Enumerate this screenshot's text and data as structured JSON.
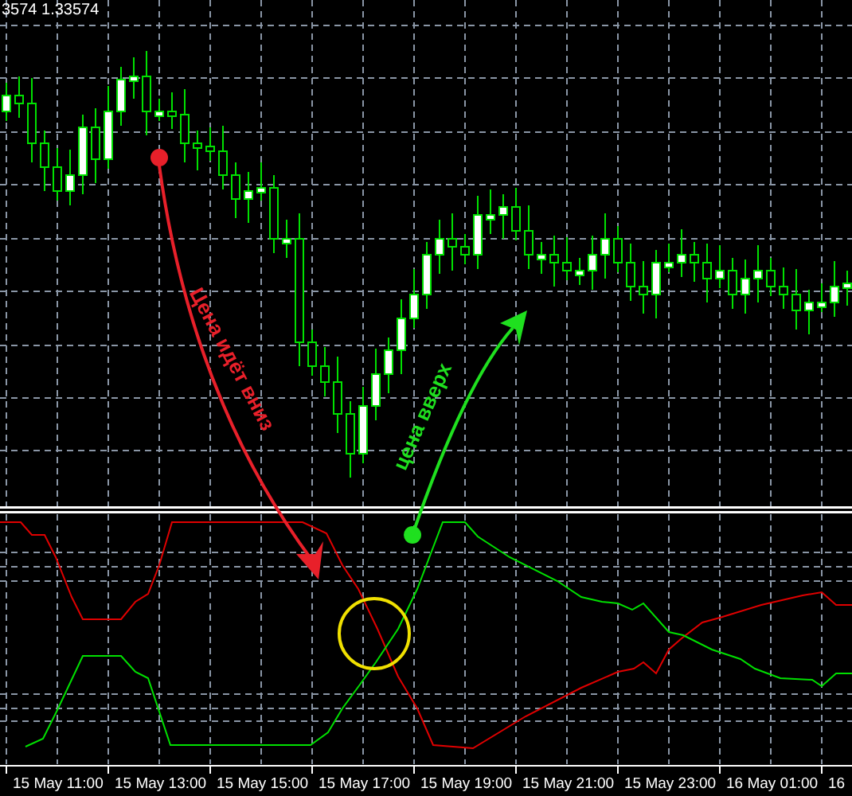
{
  "header": {
    "price_text": "3574 1.33574"
  },
  "annotations": [
    {
      "kind": "down",
      "text": "Цена идёт вниз"
    },
    {
      "kind": "up",
      "text": "цена вверх"
    }
  ],
  "time_axis": {
    "labels": [
      "15 May 11:00",
      "15 May 13:00",
      "15 May 15:00",
      "15 May 17:00",
      "15 May 19:00",
      "15 May 21:00",
      "15 May 23:00",
      "16 May 01:00",
      "16"
    ]
  }
}
